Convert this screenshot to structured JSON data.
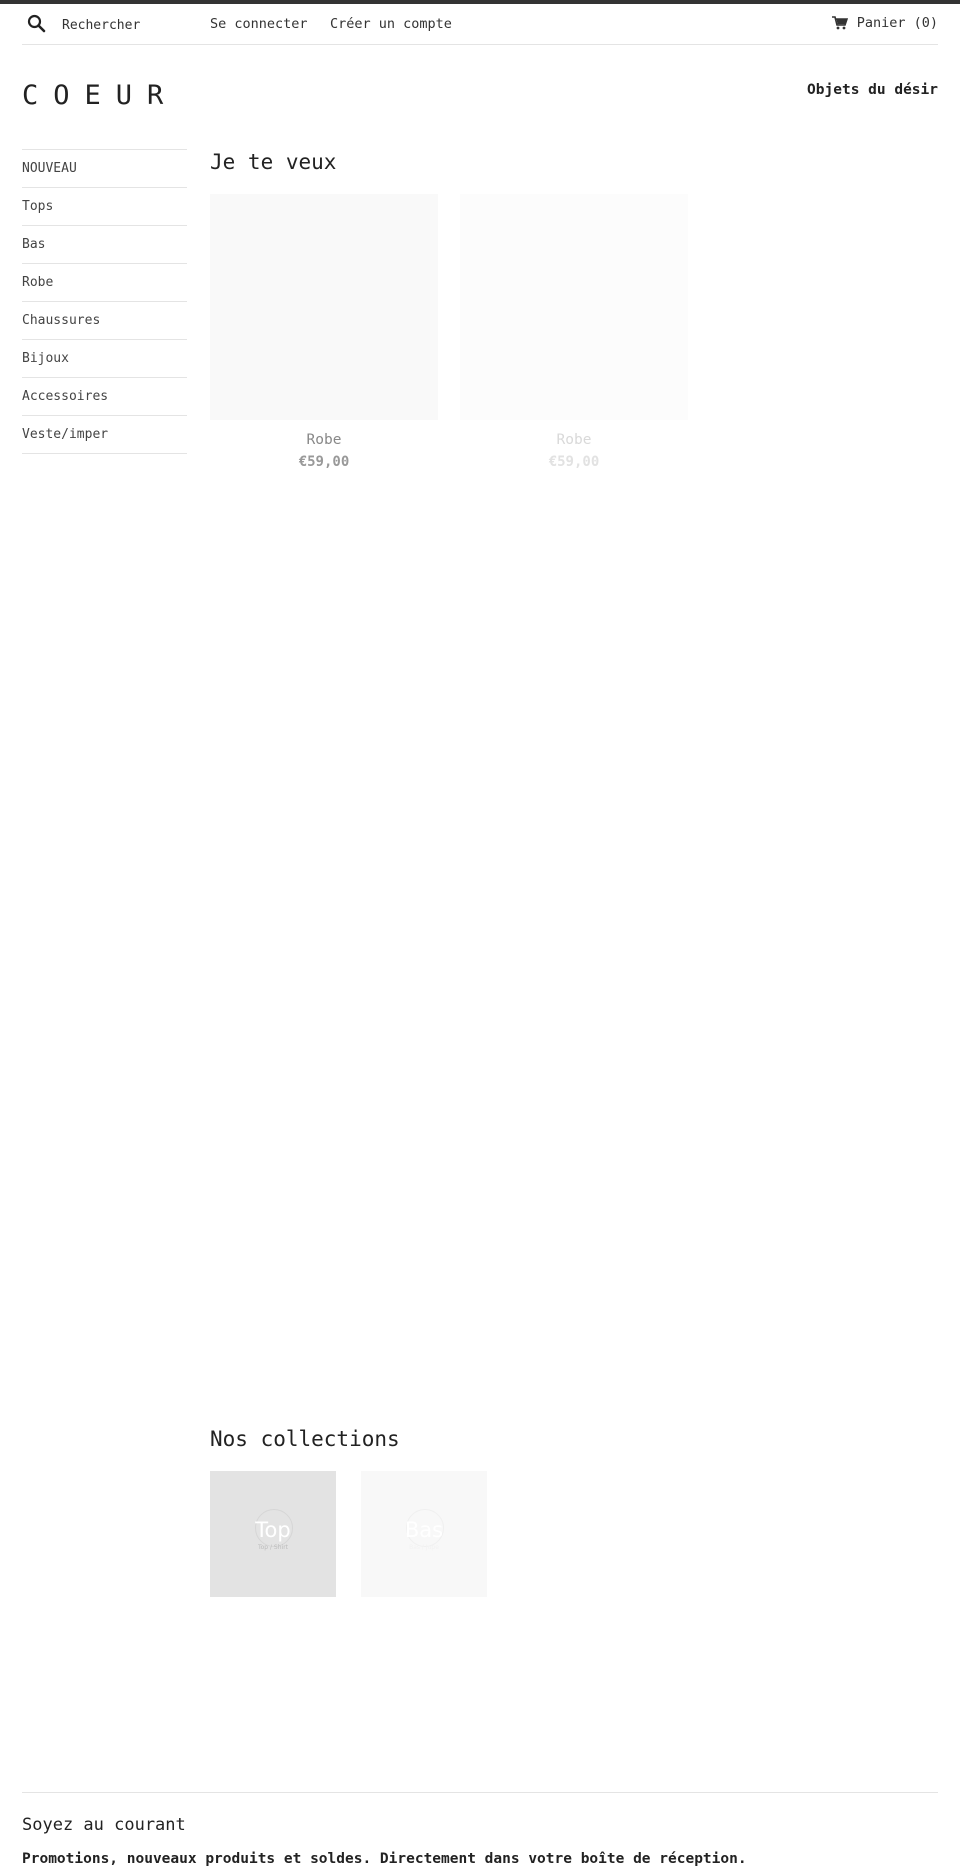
{
  "header": {
    "search_placeholder": "Rechercher",
    "login_label": "Se connecter",
    "register_label": "Créer un compte",
    "cart_label": "Panier (0)",
    "icons": {
      "search": "search-icon",
      "cart": "cart-icon"
    }
  },
  "brand": {
    "name": "COEUR",
    "tagline": "Objets du désir"
  },
  "sidebar": {
    "items": [
      {
        "label": "NOUVEAU"
      },
      {
        "label": "Tops"
      },
      {
        "label": "Bas"
      },
      {
        "label": "Robe"
      },
      {
        "label": "Chaussures"
      },
      {
        "label": "Bijoux"
      },
      {
        "label": "Accessoires"
      },
      {
        "label": "Veste/imper"
      }
    ]
  },
  "featured": {
    "title": "Je te veux",
    "products": [
      {
        "name": "Robe",
        "price": "€59,00"
      },
      {
        "name": "Robe",
        "price": "€59,00"
      }
    ]
  },
  "collections": {
    "title": "Nos collections",
    "items": [
      {
        "title": "Top",
        "subtitle": "Top / Shirt"
      },
      {
        "title": "Bas",
        "subtitle": "Bas / Jupe"
      }
    ]
  },
  "newsletter": {
    "title": "Soyez au courant",
    "text": "Promotions, nouveaux produits et soldes. Directement dans votre boîte de réception."
  },
  "colors": {
    "topbar": "#333333",
    "text": "#333333",
    "divider": "#e4e4e4"
  }
}
